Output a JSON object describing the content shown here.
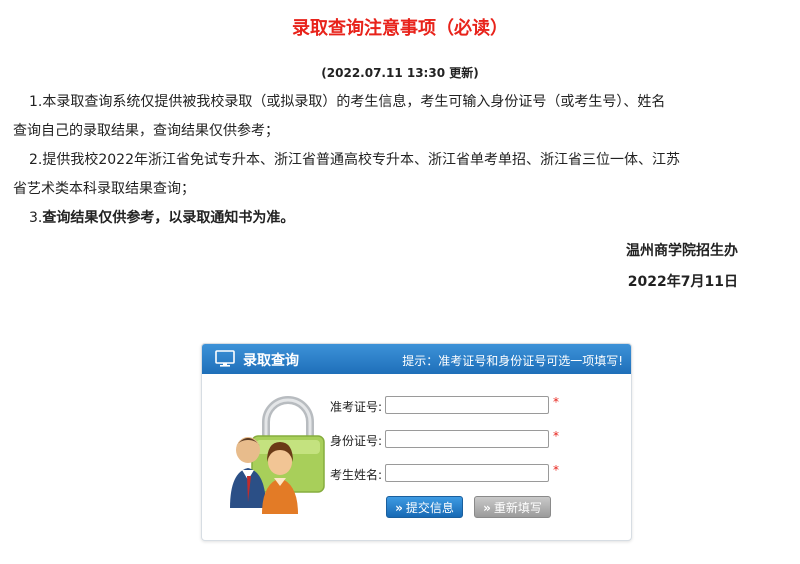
{
  "notice": {
    "title": "录取查询注意事项（必读）",
    "update": "(2022.07.11  13:30 更新)",
    "item1_line1": "1.本录取查询系统仅提供被我校录取（或拟录取）的考生信息，考生可输入身份证号（或考生号）、姓名",
    "item1_line2": "查询自己的录取结果，查询结果仅供参考；",
    "item2_line1": "2.提供我校2022年浙江省免试专升本、浙江省普通高校专升本、浙江省单考单招、浙江省三位一体、江苏",
    "item2_line2": "省艺术类本科录取结果查询；",
    "item3_prefix": "3.",
    "item3_bold": "查询结果仅供参考，以录取通知书为准。",
    "org": "温州商学院招生办",
    "date": "2022年7月11日"
  },
  "panel": {
    "title": "录取查询",
    "hint": "提示：准考证号和身份证号可选一项填写!",
    "fields": [
      {
        "label": "准考证号:",
        "value": "",
        "required": "*"
      },
      {
        "label": "身份证号:",
        "value": "",
        "required": "*"
      },
      {
        "label": "考生姓名:",
        "value": "",
        "required": "*"
      }
    ],
    "submit_label": "提交信息",
    "reset_label": "重新填写",
    "button_arrow": "»"
  },
  "colors": {
    "title_red": "#e8231b",
    "header_blue": "#1f6fb9",
    "submit_blue": "#1769b4",
    "reset_gray": "#9b9b9b"
  },
  "icons": {
    "header": "monitor-icon",
    "illustration": "lock-users-illustration"
  }
}
